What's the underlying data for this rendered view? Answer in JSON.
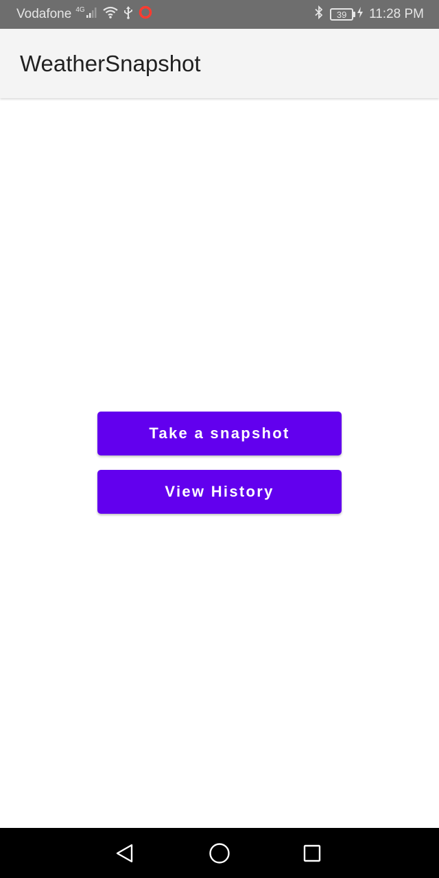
{
  "status_bar": {
    "carrier": "Vodafone",
    "network_type": "4G",
    "battery_level": "39",
    "time": "11:28 PM",
    "icons": [
      "signal-icon",
      "wifi-icon",
      "usb-icon",
      "notification-ring-icon",
      "bluetooth-icon",
      "battery-icon",
      "charging-icon"
    ],
    "alert_color": "#ff3b30"
  },
  "app_bar": {
    "title": "WeatherSnapshot"
  },
  "main": {
    "take_snapshot_label": "Take a snapshot",
    "view_history_label": "View History",
    "accent_color": "#6200ee"
  },
  "nav_bar": {
    "icons": [
      "back-icon",
      "home-icon",
      "recent-apps-icon"
    ]
  }
}
